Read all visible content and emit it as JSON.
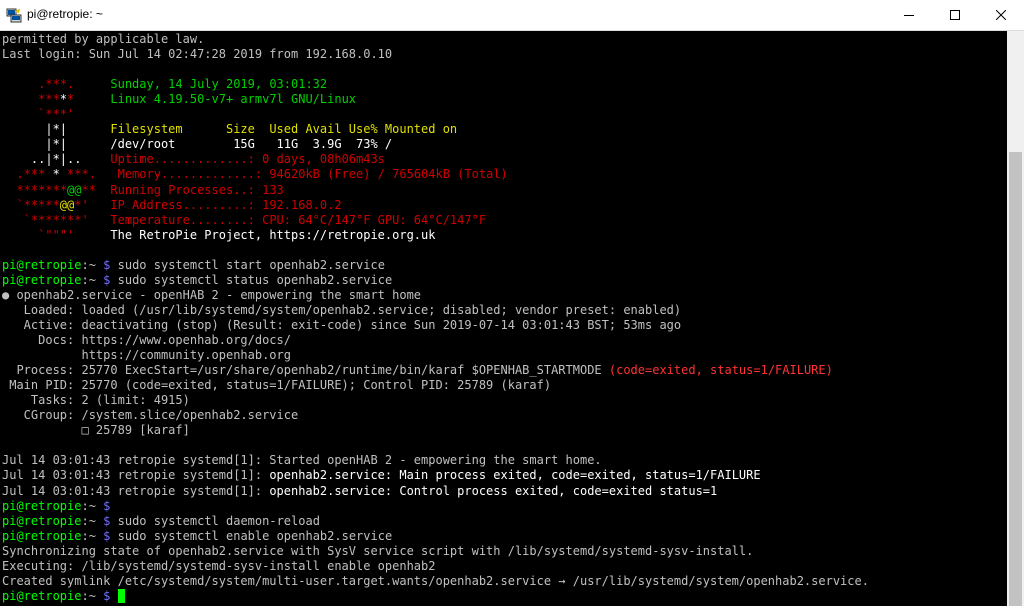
{
  "window": {
    "title": "pi@retropie: ~",
    "buttons": {
      "minimize": "minimize",
      "maximize": "maximize",
      "close": "close"
    }
  },
  "colors": {
    "default": "#c0c0c0",
    "white": "#ffffff",
    "green": "#00d000",
    "bright_green": "#00ff00",
    "red": "#d00000",
    "bright_red": "#ff3333",
    "yellow": "#e0e000",
    "blue": "#7070ff",
    "cursor": "#00ff00"
  },
  "terminal": {
    "lines": [
      [
        {
          "t": "permitted by applicable law.",
          "c": "default"
        }
      ],
      [
        {
          "t": "Last login: Sun Jul 14 02:47:28 2019 from 192.168.0.10",
          "c": "default"
        }
      ],
      [
        {
          "t": "",
          "c": "default"
        }
      ],
      [
        {
          "t": "     .***.     ",
          "c": "red"
        },
        {
          "t": "Sunday, 14 July 2019, 03:01:32",
          "c": "green"
        }
      ],
      [
        {
          "t": "     ***",
          "c": "red"
        },
        {
          "t": "*",
          "c": "white"
        },
        {
          "t": "*     ",
          "c": "red"
        },
        {
          "t": "Linux 4.19.50-v7+ armv7l GNU/Linux",
          "c": "green"
        }
      ],
      [
        {
          "t": "     `***'",
          "c": "red"
        }
      ],
      [
        {
          "t": "      |*|      ",
          "c": "white"
        },
        {
          "t": "Filesystem      Size  Used Avail Use% Mounted on",
          "c": "yellow"
        }
      ],
      [
        {
          "t": "      |*|      /dev/root        15G   11G  3.9G  73% /",
          "c": "white"
        }
      ],
      [
        {
          "t": "    ..|*|..    ",
          "c": "white"
        },
        {
          "t": "Uptime.............: 0 days, 08h06m43s",
          "c": "red"
        }
      ],
      [
        {
          "t": "  .*** ",
          "c": "red"
        },
        {
          "t": "*",
          "c": "white"
        },
        {
          "t": " ***.   ",
          "c": "red"
        },
        {
          "t": "Memory.............: 94620kB (Free) / 765604kB (Total)",
          "c": "red"
        }
      ],
      [
        {
          "t": "  *******",
          "c": "red"
        },
        {
          "t": "@@",
          "c": "green"
        },
        {
          "t": "**  ",
          "c": "red"
        },
        {
          "t": "Running Processes..: 133",
          "c": "red"
        }
      ],
      [
        {
          "t": "  `*****",
          "c": "red"
        },
        {
          "t": "@@",
          "c": "yellow"
        },
        {
          "t": "*'   ",
          "c": "red"
        },
        {
          "t": "IP Address.........: 192.168.0.2",
          "c": "red"
        }
      ],
      [
        {
          "t": "   `*******'   ",
          "c": "red"
        },
        {
          "t": "Temperature........: CPU: 64°C/147°F GPU: 64°C/147°F",
          "c": "red"
        }
      ],
      [
        {
          "t": "     `\"\"\"'     ",
          "c": "red"
        },
        {
          "t": "The RetroPie Project, https://retropie.org.uk",
          "c": "white"
        }
      ],
      [
        {
          "t": "",
          "c": "default"
        }
      ],
      [
        {
          "t": "pi@retropie",
          "c": "bright_green"
        },
        {
          "t": ":~ ",
          "c": "default"
        },
        {
          "t": "$",
          "c": "blue"
        },
        {
          "t": " sudo systemctl start openhab2.service",
          "c": "default"
        }
      ],
      [
        {
          "t": "pi@retropie",
          "c": "bright_green"
        },
        {
          "t": ":~ ",
          "c": "default"
        },
        {
          "t": "$",
          "c": "blue"
        },
        {
          "t": " sudo systemctl status openhab2.service",
          "c": "default"
        }
      ],
      [
        {
          "t": "● openhab2.service - openHAB 2 - empowering the smart home",
          "c": "default"
        }
      ],
      [
        {
          "t": "   Loaded: loaded (/usr/lib/systemd/system/openhab2.service; disabled; vendor preset: enabled)",
          "c": "default"
        }
      ],
      [
        {
          "t": "   Active: deactivating (stop) (Result: exit-code) since Sun 2019-07-14 03:01:43 BST; 53ms ago",
          "c": "default"
        }
      ],
      [
        {
          "t": "     Docs: https://www.openhab.org/docs/",
          "c": "default"
        }
      ],
      [
        {
          "t": "           https://community.openhab.org",
          "c": "default"
        }
      ],
      [
        {
          "t": "  Process: 25770 ExecStart=/usr/share/openhab2/runtime/bin/karaf $OPENHAB_STARTMODE ",
          "c": "default"
        },
        {
          "t": "(code=exited, status=1/FAILURE)",
          "c": "bright_red"
        }
      ],
      [
        {
          "t": " Main PID: 25770 (code=exited, status=1/FAILURE); Control PID: 25789 (karaf)",
          "c": "default"
        }
      ],
      [
        {
          "t": "    Tasks: 2 (limit: 4915)",
          "c": "default"
        }
      ],
      [
        {
          "t": "   CGroup: /system.slice/openhab2.service",
          "c": "default"
        }
      ],
      [
        {
          "t": "           □ 25789 [karaf]",
          "c": "default"
        }
      ],
      [
        {
          "t": "",
          "c": "default"
        }
      ],
      [
        {
          "t": "Jul 14 03:01:43 retropie systemd[1]: Started openHAB 2 - empowering the smart home.",
          "c": "default"
        }
      ],
      [
        {
          "t": "Jul 14 03:01:43 retropie systemd[1]: ",
          "c": "default"
        },
        {
          "t": "openhab2.service: Main process exited, code=exited, status=1/FAILURE",
          "c": "white"
        }
      ],
      [
        {
          "t": "Jul 14 03:01:43 retropie systemd[1]: ",
          "c": "default"
        },
        {
          "t": "openhab2.service: Control process exited, code=exited status=1",
          "c": "white"
        }
      ],
      [
        {
          "t": "pi@retropie",
          "c": "bright_green"
        },
        {
          "t": ":~ ",
          "c": "default"
        },
        {
          "t": "$",
          "c": "blue"
        }
      ],
      [
        {
          "t": "pi@retropie",
          "c": "bright_green"
        },
        {
          "t": ":~ ",
          "c": "default"
        },
        {
          "t": "$",
          "c": "blue"
        },
        {
          "t": " sudo systemctl daemon-reload",
          "c": "default"
        }
      ],
      [
        {
          "t": "pi@retropie",
          "c": "bright_green"
        },
        {
          "t": ":~ ",
          "c": "default"
        },
        {
          "t": "$",
          "c": "blue"
        },
        {
          "t": " sudo systemctl enable openhab2.service",
          "c": "default"
        }
      ],
      [
        {
          "t": "Synchronizing state of openhab2.service with SysV service script with /lib/systemd/systemd-sysv-install.",
          "c": "default"
        }
      ],
      [
        {
          "t": "Executing: /lib/systemd/systemd-sysv-install enable openhab2",
          "c": "default"
        }
      ],
      [
        {
          "t": "Created symlink /etc/systemd/system/multi-user.target.wants/openhab2.service → /usr/lib/systemd/system/openhab2.service.",
          "c": "default"
        }
      ],
      [
        {
          "t": "pi@retropie",
          "c": "bright_green"
        },
        {
          "t": ":~ ",
          "c": "default"
        },
        {
          "t": "$",
          "c": "blue"
        },
        {
          "t": " ",
          "c": "default"
        }
      ]
    ]
  }
}
